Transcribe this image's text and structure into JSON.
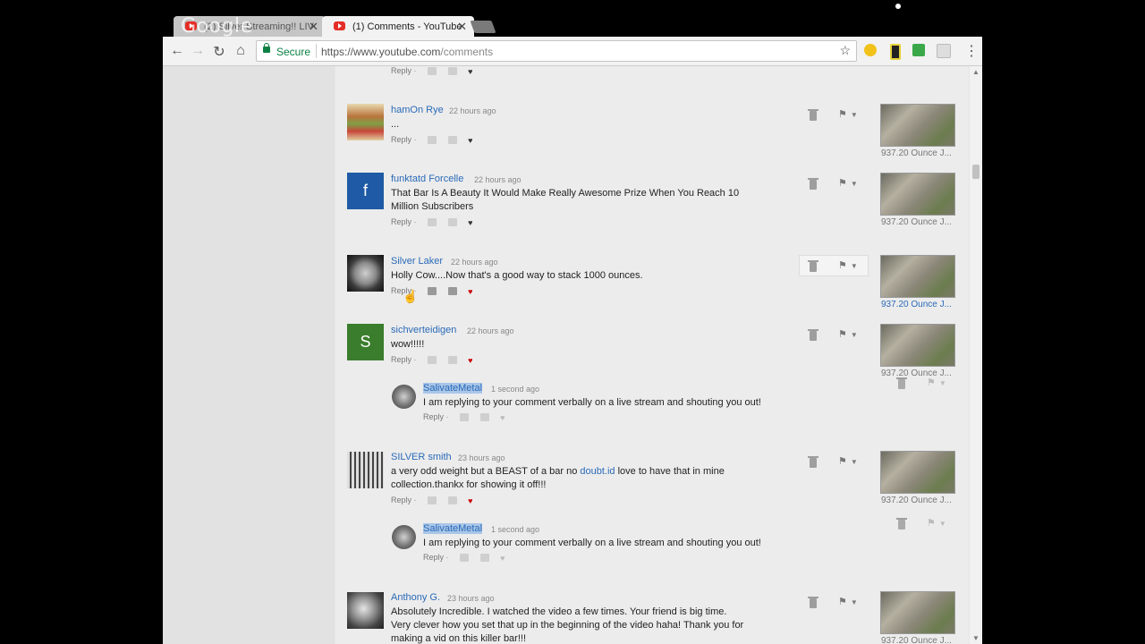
{
  "browser": {
    "tabs": [
      {
        "title": "(2) Silver Streaming!! LIV",
        "active": false
      },
      {
        "title": "(1) Comments - YouTube",
        "active": true
      }
    ],
    "brand_overlay": "Google",
    "address": {
      "secure_label": "Secure",
      "url_host": "https://www.youtube.com",
      "url_path": "/comments"
    }
  },
  "labels": {
    "reply": "Reply",
    "dot": "·"
  },
  "colors": {
    "link_blue": "#2a6ab8",
    "highlight": "#a9c6e8",
    "secure_green": "#0b8043"
  },
  "comments": [
    {
      "author": "hamOn Rye",
      "time": "22 hours ago",
      "text": "...",
      "video_title": "937.20 Ounce J..."
    },
    {
      "author": "funktatd Forcelle",
      "avatar_letter": "f",
      "time": "22 hours ago",
      "text": "That Bar Is A Beauty It Would Make Really Awesome Prize When You Reach 10 Million Subscribers",
      "video_title": "937.20 Ounce J..."
    },
    {
      "author": "Silver Laker",
      "time": "22 hours ago",
      "text": "Holly Cow....Now that's a good way to stack 1000 ounces.",
      "video_title": "937.20 Ounce J..."
    },
    {
      "author": "sichverteidigen",
      "avatar_letter": "S",
      "time": "22 hours ago",
      "text": "wow!!!!!",
      "video_title": "937.20 Ounce J..."
    },
    {
      "author": "SILVER smith",
      "time": "23 hours ago",
      "text_before_link": "a very odd weight but a BEAST of a bar no ",
      "link": "doubt.id",
      "text_after_link": " love to have that in mine collection.thankx for showing it off!!!",
      "video_title": "937.20 Ounce J..."
    },
    {
      "author": "Anthony G.",
      "time": "23 hours ago",
      "text": "Absolutely Incredible.  I watched the video a few times.  Your friend is big time.  Very clever how you set that up in the beginning of the video haha!  Thank you for making a vid on this killer bar!!!",
      "video_title": "937.20 Ounce J..."
    }
  ],
  "replies": [
    {
      "author": "SalivateMetal",
      "time": "1 second ago",
      "text": "I am replying to your comment verbally on a live stream and shouting you out!"
    },
    {
      "author": "SalivateMetal",
      "time": "1 second ago",
      "text": "I am replying to your comment verbally on a live stream and shouting you out!"
    }
  ]
}
